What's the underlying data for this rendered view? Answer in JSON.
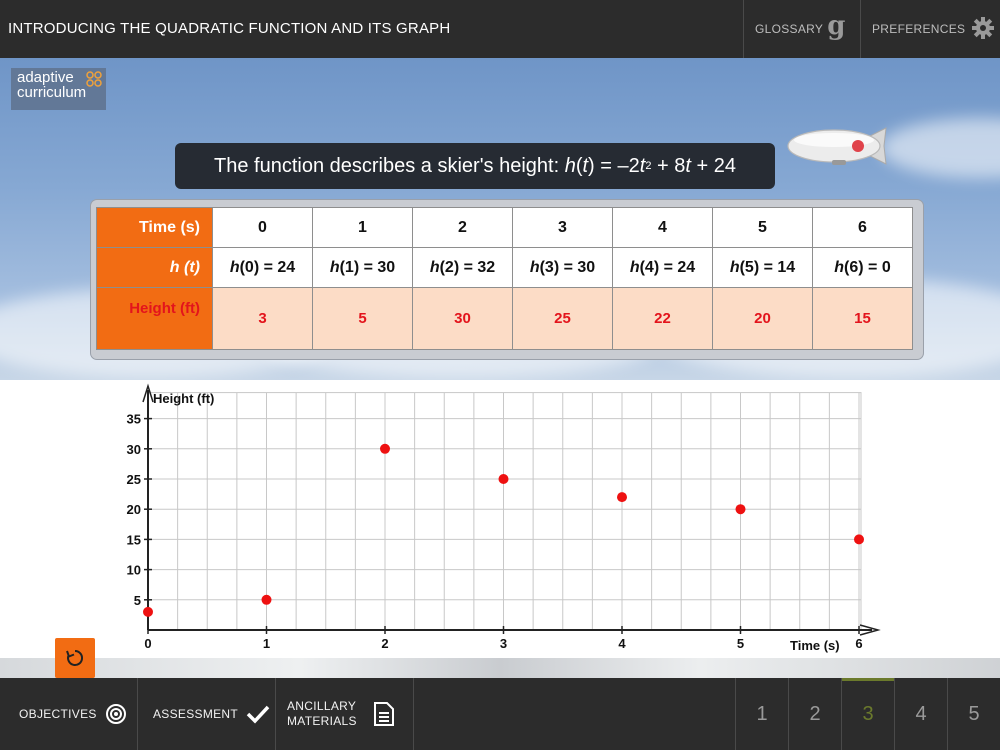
{
  "header": {
    "title": "INTRODUCING THE QUADRATIC FUNCTION AND ITS GRAPH",
    "glossary_label": "GLOSSARY",
    "glossary_icon_glyph": "g",
    "preferences_label": "PREFERENCES"
  },
  "logo": {
    "line1": "adaptive",
    "line2": "curriculum"
  },
  "banner": {
    "prefix": "The function describes a skier's height: ",
    "func_name": "h",
    "var": "t",
    "eq_part1": " = –2",
    "exp": "2",
    "eq_part2": " + 8",
    "eq_part3": " + 24"
  },
  "table": {
    "row_headers": [
      "Time (s)",
      "h (t)",
      "Height (ft)"
    ],
    "times": [
      "0",
      "1",
      "2",
      "3",
      "4",
      "5",
      "6"
    ],
    "h_values": [
      "h(0) = 24",
      "h(1) = 30",
      "h(2) = 32",
      "h(3) = 30",
      "h(4) = 24",
      "h(5) = 14",
      "h(6) = 0"
    ],
    "heights": [
      "3",
      "5",
      "30",
      "25",
      "22",
      "20",
      "15"
    ]
  },
  "chart_data": {
    "type": "scatter",
    "xlabel": "Time (s)",
    "ylabel": "Height (ft)",
    "x_ticks": [
      "0",
      "1",
      "2",
      "3",
      "4",
      "5",
      "6"
    ],
    "y_ticks": [
      "5",
      "10",
      "15",
      "20",
      "25",
      "30",
      "35"
    ],
    "xlim": [
      0,
      6
    ],
    "ylim": [
      0,
      35
    ],
    "points": [
      {
        "x": 0,
        "y": 3
      },
      {
        "x": 1,
        "y": 5
      },
      {
        "x": 2,
        "y": 30
      },
      {
        "x": 3,
        "y": 25
      },
      {
        "x": 4,
        "y": 22
      },
      {
        "x": 5,
        "y": 20
      },
      {
        "x": 6,
        "y": 15
      }
    ],
    "point_color": "#ee1111",
    "grid": true
  },
  "footer": {
    "objectives_label": "OBJECTIVES",
    "assessment_label": "ASSESSMENT",
    "ancillary_line1": "ANCILLARY",
    "ancillary_line2": "MATERIALS",
    "pages": [
      "1",
      "2",
      "3",
      "4",
      "5"
    ],
    "active_page": "3"
  },
  "colors": {
    "accent": "#f26c13",
    "bar": "#2c2c2c",
    "active_page": "#6b7a2c"
  }
}
